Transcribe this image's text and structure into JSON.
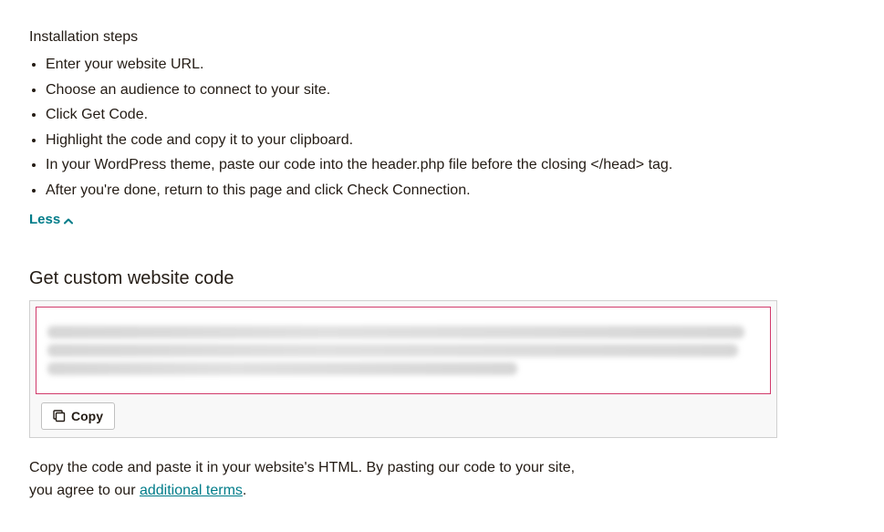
{
  "installation": {
    "title": "Installation steps",
    "steps": [
      "Enter your website URL.",
      "Choose an audience to connect to your site.",
      "Click Get Code.",
      "Highlight the code and copy it to your clipboard.",
      "In your WordPress theme, paste our code into the header.php file before the closing </head> tag.",
      "After you're done, return to this page and click Check Connection."
    ],
    "toggle_label": "Less"
  },
  "custom_code": {
    "heading": "Get custom website code",
    "copy_label": "Copy"
  },
  "footer": {
    "line1": "Copy the code and paste it in your website's HTML. By pasting our code to your site,",
    "line2_prefix": "you agree to our ",
    "terms_link": "additional terms",
    "line2_suffix": "."
  }
}
